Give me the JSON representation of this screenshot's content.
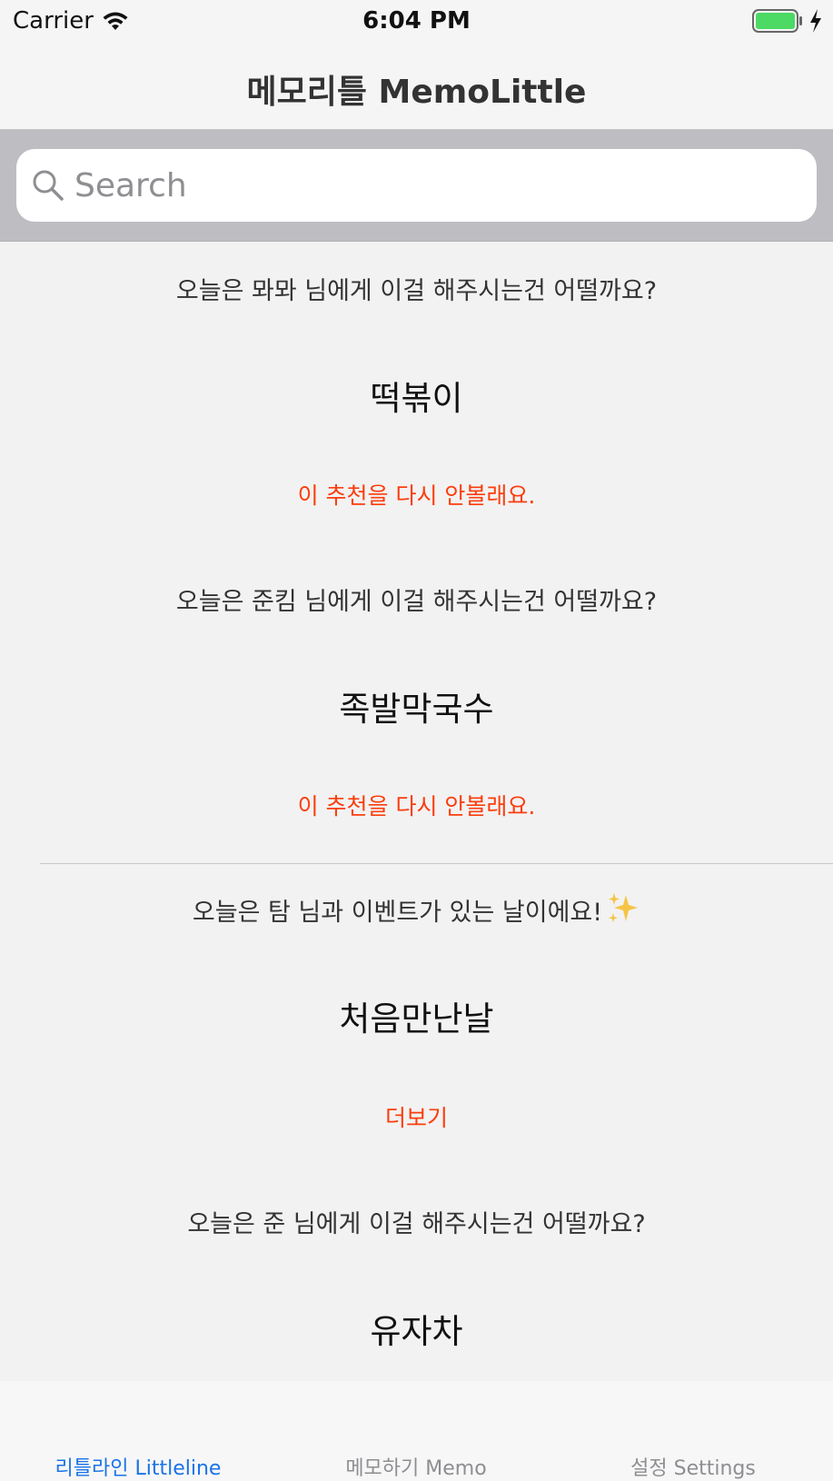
{
  "status_bar": {
    "carrier": "Carrier",
    "time": "6:04 PM",
    "battery_color": "#4cd964"
  },
  "nav": {
    "title": "메모리틀 MemoLittle"
  },
  "search": {
    "placeholder": "Search"
  },
  "cards": [
    {
      "question": "오늘은 뫄뫄 님에게 이걸 해주시는건 어떨까요?",
      "item": "떡볶이",
      "action": "이 추천을 다시 안볼래요."
    },
    {
      "question": "오늘은 준킴 님에게 이걸 해주시는건 어떨까요?",
      "item": "족발막국수",
      "action": "이 추천을 다시 안볼래요."
    },
    {
      "question": "오늘은 탐 님과 이벤트가 있는 날이에요!",
      "item": "처음만난날",
      "action": "더보기"
    },
    {
      "question": "오늘은 준 님에게 이걸 해주시는건 어떨까요?",
      "item": "유자차"
    }
  ],
  "tabs": [
    {
      "label": "리틀라인 Littleline",
      "active": true
    },
    {
      "label": "메모하기 Memo",
      "active": false
    },
    {
      "label": "설정 Settings",
      "active": false
    }
  ],
  "colors": {
    "accent": "#1a73e8",
    "action": "#fc3d0d"
  }
}
